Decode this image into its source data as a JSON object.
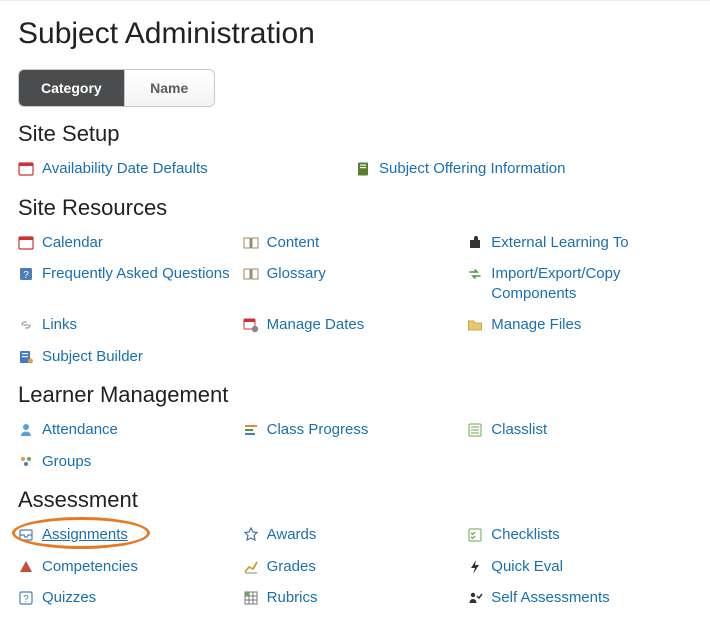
{
  "page": {
    "title": "Subject Administration"
  },
  "tabs": {
    "category": "Category",
    "name": "Name",
    "active": "category"
  },
  "sections": {
    "site_setup": {
      "heading": "Site Setup",
      "items": [
        {
          "label": "Availability Date Defaults",
          "icon": "calendar-red"
        },
        {
          "label": "Subject Offering Information",
          "icon": "info-book"
        }
      ]
    },
    "site_resources": {
      "heading": "Site Resources",
      "items": [
        {
          "label": "Calendar",
          "icon": "calendar-red"
        },
        {
          "label": "Content",
          "icon": "open-book"
        },
        {
          "label": "External Learning To",
          "icon": "puzzle"
        },
        {
          "label": "Frequently Asked Questions",
          "icon": "faq"
        },
        {
          "label": "Glossary",
          "icon": "open-book"
        },
        {
          "label": "Import/Export/Copy Components",
          "icon": "transfer"
        },
        {
          "label": "Links",
          "icon": "link"
        },
        {
          "label": "Manage Dates",
          "icon": "cal-gear"
        },
        {
          "label": "Manage Files",
          "icon": "folder"
        },
        {
          "label": "Subject Builder",
          "icon": "builder"
        }
      ]
    },
    "learner_management": {
      "heading": "Learner Management",
      "items": [
        {
          "label": "Attendance",
          "icon": "person"
        },
        {
          "label": "Class Progress",
          "icon": "bars"
        },
        {
          "label": "Classlist",
          "icon": "list"
        },
        {
          "label": "Groups",
          "icon": "groups"
        }
      ]
    },
    "assessment": {
      "heading": "Assessment",
      "items": [
        {
          "label": "Assignments",
          "icon": "inbox",
          "highlighted": true
        },
        {
          "label": "Awards",
          "icon": "award"
        },
        {
          "label": "Checklists",
          "icon": "checklist"
        },
        {
          "label": "Competencies",
          "icon": "triangle"
        },
        {
          "label": "Grades",
          "icon": "chart-up"
        },
        {
          "label": "Quick Eval",
          "icon": "lightning"
        },
        {
          "label": "Quizzes",
          "icon": "question"
        },
        {
          "label": "Rubrics",
          "icon": "rubric"
        },
        {
          "label": "Self Assessments",
          "icon": "self"
        }
      ]
    }
  }
}
